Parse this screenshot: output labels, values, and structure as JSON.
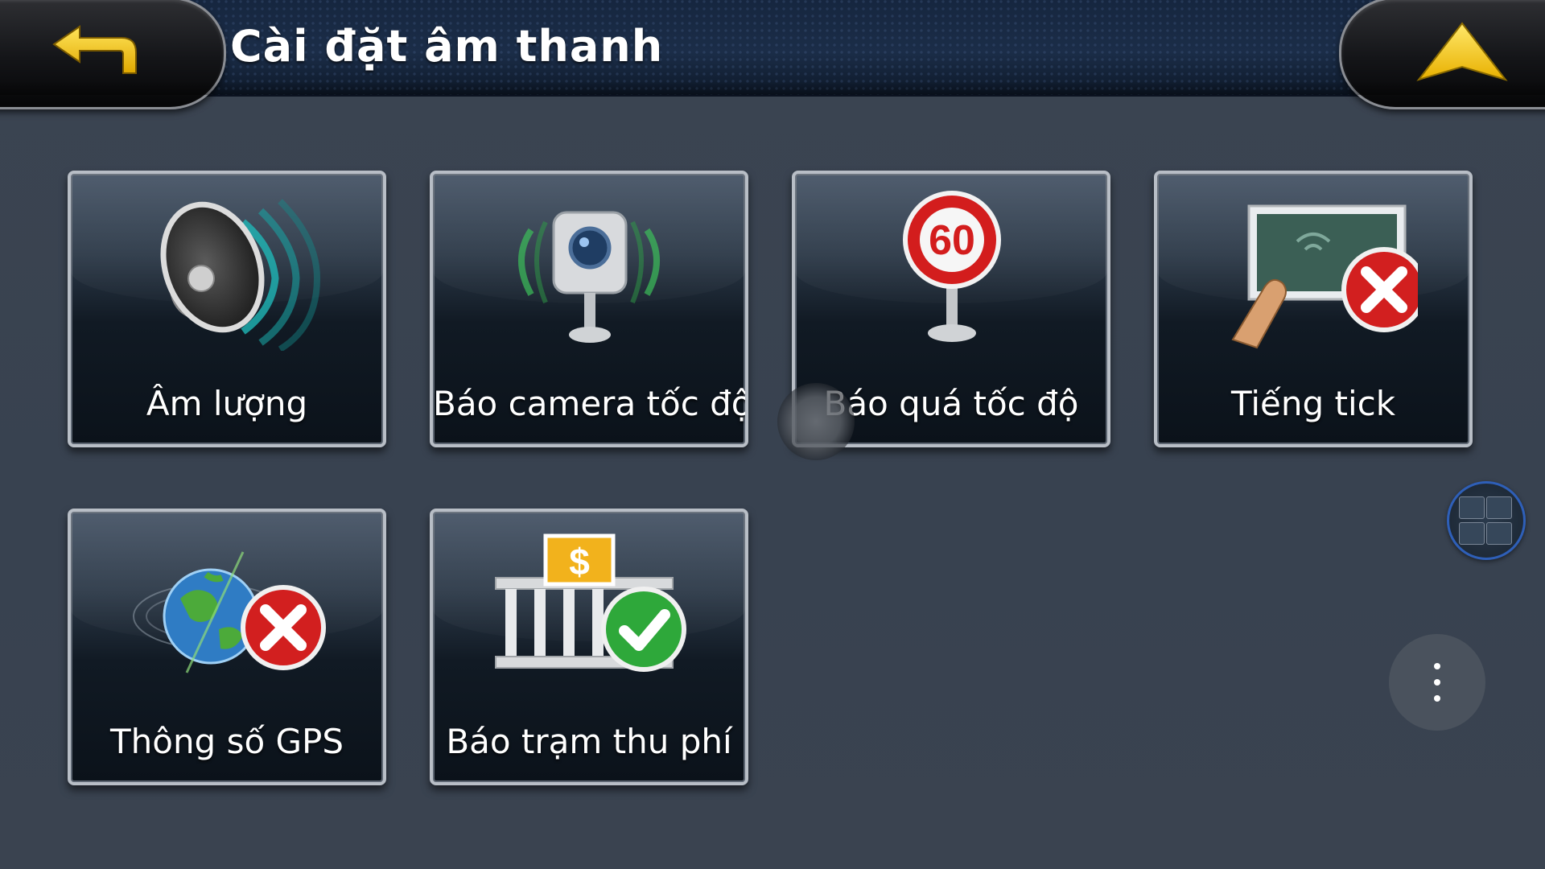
{
  "header": {
    "title": "Cài đặt âm thanh",
    "back_icon": "back-arrow-icon",
    "up_icon": "up-arrow-icon",
    "accent_color": "#f5c400"
  },
  "tiles": [
    {
      "label": "Âm lượng",
      "icon": "speaker-icon"
    },
    {
      "label": "Báo camera tốc độ",
      "icon": "speed-camera-icon"
    },
    {
      "label": "Báo quá tốc độ",
      "icon": "speed-limit-sign-icon",
      "sign_text": "60"
    },
    {
      "label": "Tiếng tick",
      "icon": "touch-screen-icon",
      "status": "off"
    },
    {
      "label": "Thông số GPS",
      "icon": "globe-gps-icon",
      "status": "off"
    },
    {
      "label": "Báo trạm thu phí",
      "icon": "toll-station-icon",
      "status": "on",
      "sign_text": "$"
    }
  ],
  "overlays": {
    "floating_bubble_icon": "app-switcher-icon",
    "more_icon": "more-vert-icon"
  }
}
